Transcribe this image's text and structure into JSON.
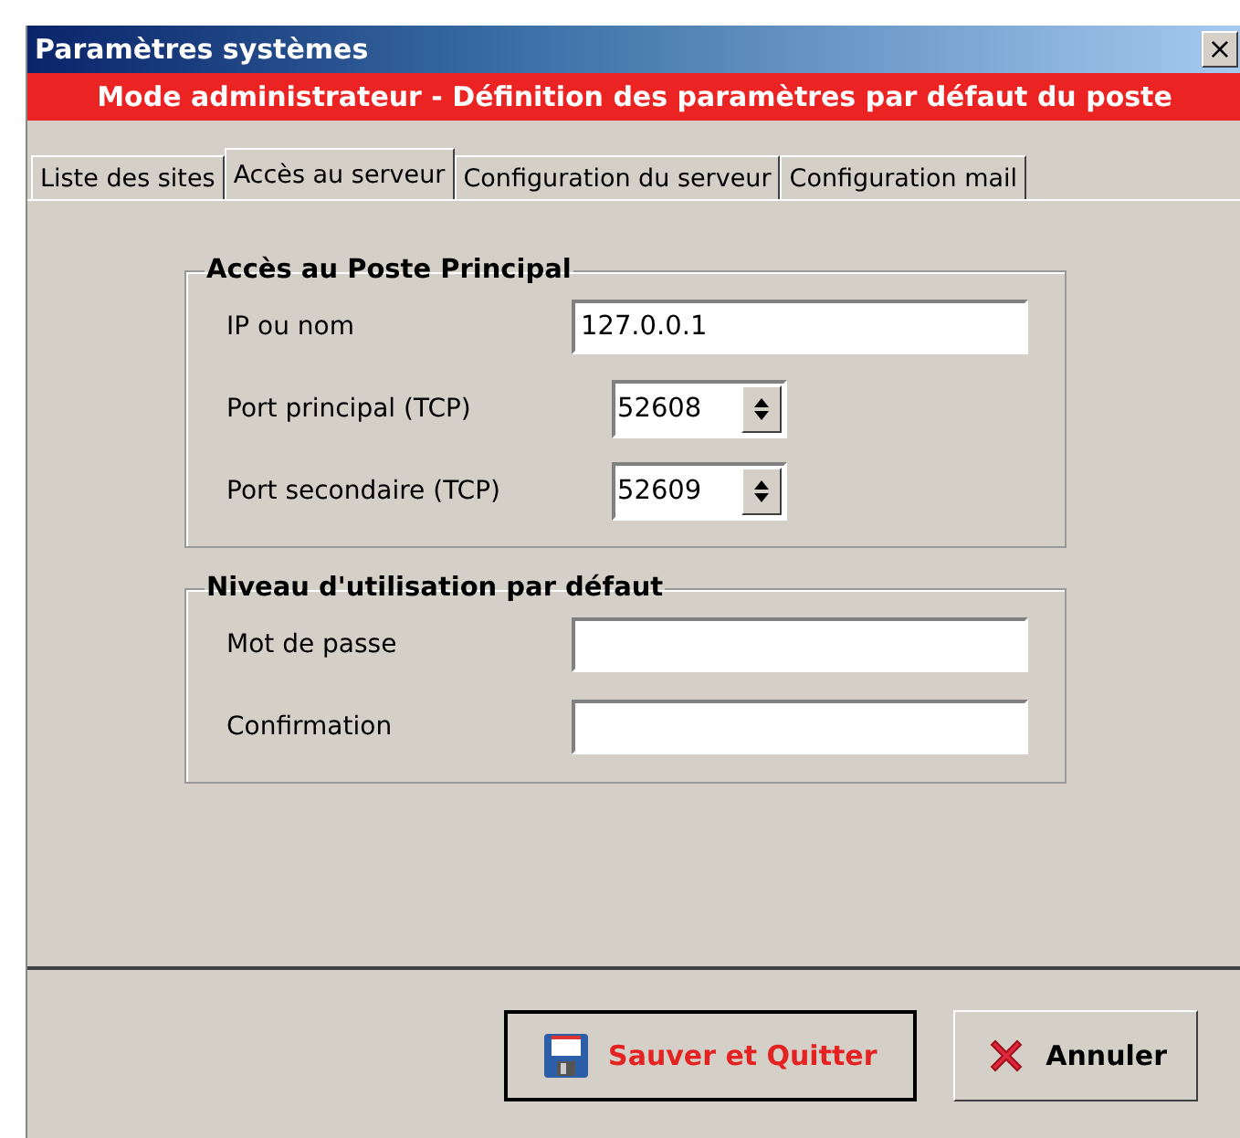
{
  "window": {
    "title": "Paramètres systèmes",
    "close": "×"
  },
  "banner": "Mode administrateur - Définition des paramètres par défaut du poste",
  "tabs": [
    {
      "label": "Liste des sites",
      "selected": false
    },
    {
      "label": "Accès au serveur",
      "selected": true
    },
    {
      "label": "Configuration du serveur",
      "selected": false
    },
    {
      "label": "Configuration mail",
      "selected": false
    }
  ],
  "groups": [
    {
      "title": "Accès au Poste Principal",
      "fields": [
        {
          "label": "IP ou nom",
          "kind": "text",
          "value": "127.0.0.1"
        },
        {
          "label": "Port principal (TCP)",
          "kind": "spin",
          "value": "52608"
        },
        {
          "label": "Port secondaire (TCP)",
          "kind": "spin",
          "value": "52609"
        }
      ]
    },
    {
      "title": "Niveau d'utilisation par défaut",
      "fields": [
        {
          "label": "Mot de passe",
          "kind": "password"
        },
        {
          "label": "Confirmation",
          "kind": "password"
        }
      ]
    }
  ],
  "buttons": [
    {
      "label": "Sauver et Quitter",
      "kind": "save"
    },
    {
      "label": "Annuler",
      "kind": "cancel"
    }
  ]
}
